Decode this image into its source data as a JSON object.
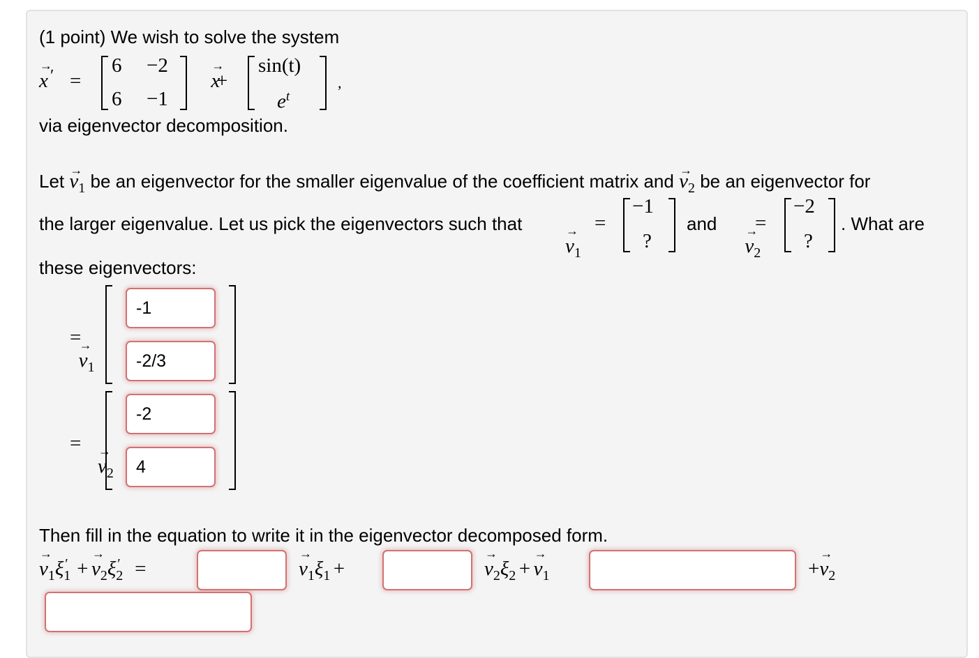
{
  "problem": {
    "intro": "(1 point) We wish to solve the system",
    "system": {
      "lhs": "x′",
      "matrix": [
        [
          "6",
          "−2"
        ],
        [
          "6",
          "−1"
        ]
      ],
      "x": "x",
      "plus": "+",
      "forcing": [
        "sin(t)",
        "e"
      ],
      "forcing_exp": "t",
      "comma": ","
    },
    "via": "via eigenvector decomposition.",
    "para1_a": "Let",
    "para1_b": "be an eigenvector for the smaller eigenvalue of the coefficient matrix and",
    "para1_c": "be an eigenvector for",
    "para2_a": "the larger eigenvalue. Let us pick the eigenvectors such that",
    "para2_and": "and",
    "para2_end": ". What are",
    "v1_hint": [
      "−1",
      "?"
    ],
    "v2_hint": [
      "−2",
      "?"
    ],
    "para3": "these eigenvectors:",
    "v_symbol": "v",
    "eq": "=",
    "sub1": "1",
    "sub2": "2"
  },
  "eigenvectors": {
    "v1": [
      "-1",
      "-2/3"
    ],
    "v2": [
      "-2",
      "4"
    ]
  },
  "decomposition": {
    "instruction": "Then fill in the equation to write it in the eigenvector decomposed form.",
    "xi": "ξ",
    "prime": "′",
    "plus": "+",
    "inputs": [
      "",
      "",
      "",
      ""
    ]
  }
}
